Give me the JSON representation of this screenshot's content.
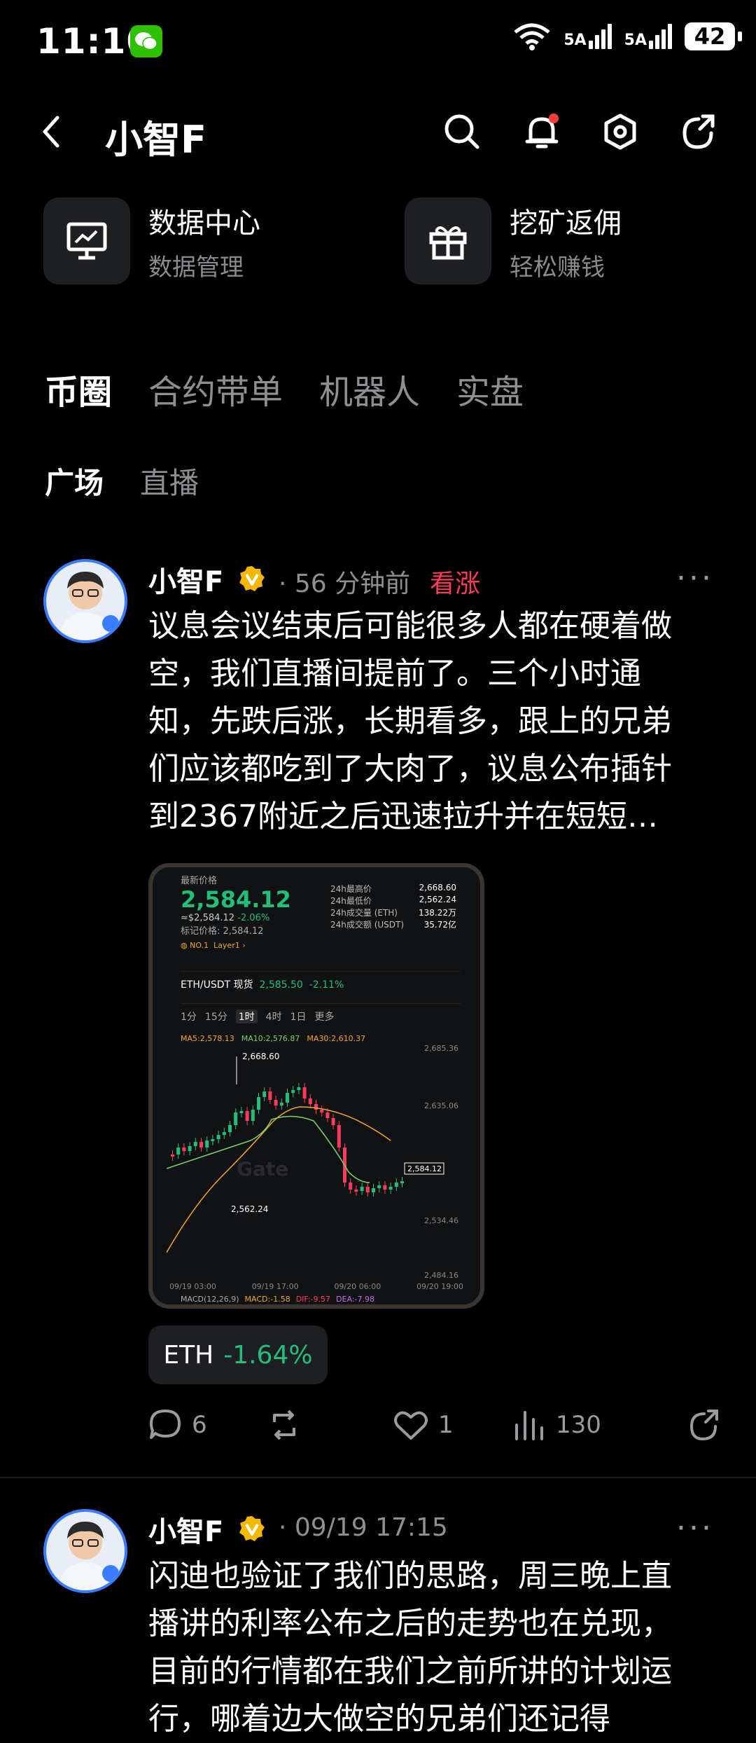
{
  "status_bar": {
    "time": "11:10",
    "net1": "5A",
    "net2": "5A",
    "battery": "42"
  },
  "header": {
    "title": "小智F"
  },
  "quick_cards": [
    {
      "title": "数据中心",
      "subtitle": "数据管理"
    },
    {
      "title": "挖矿返佣",
      "subtitle": "轻松赚钱"
    }
  ],
  "tabs": [
    "币圈",
    "合约带单",
    "机器人",
    "实盘"
  ],
  "subtabs": [
    "广场",
    "直播"
  ],
  "post1": {
    "author": "小智F",
    "time": "· 56 分钟前",
    "sentiment": "看涨",
    "lines": [
      "议息会议结束后可能很多人都在硬着做",
      "空，我们直播间提前了。三个小时通",
      "知，先跌后涨，长期看多，跟上的兄弟",
      "们应该都吃到了大肉了，议息公布插针",
      "到2367附近之后迅速拉升并在短短…"
    ],
    "chart": {
      "label": "最新价格",
      "price": "2,584.12",
      "usd": "≈$2,584.12",
      "change": "-2.06%",
      "mark": "标记价格: 2,584.12",
      "rank": "NO.1",
      "layer": "Layer1",
      "stats": [
        {
          "k": "24h最高价",
          "v": "2,668.60"
        },
        {
          "k": "24h最低价",
          "v": "2,562.24"
        },
        {
          "k": "24h成交量 (ETH)",
          "v": "138.22万"
        },
        {
          "k": "24h成交额 (USDT)",
          "v": "35.72亿"
        }
      ],
      "pair": "ETH/USDT 现货",
      "pair_price": "2,585.50",
      "pair_change": "-2.11%",
      "intervals": [
        "1分",
        "15分",
        "1时",
        "4时",
        "1日",
        "更多"
      ],
      "ma": {
        "ma5": "MA5:2,578.13",
        "ma10": "MA10:2,576.87",
        "ma30": "MA30:2,610.37"
      },
      "y_ticks": [
        "2,685.36",
        "2,635.06",
        "2,584.12",
        "2,534.46",
        "2,484.16"
      ],
      "high_label": "2,668.60",
      "low_label": "2,562.24",
      "x_ticks": [
        "09/19 03:00",
        "09/19 17:00",
        "09/20 06:00",
        "09/20 19:00"
      ],
      "macd": {
        "title": "MACD(12,26,9)",
        "macd": "MACD:-1.58",
        "dif": "DIF:-9.57",
        "dea": "DEA:-7.98"
      },
      "watermark": "Gate"
    },
    "tag": {
      "coin": "ETH",
      "change": "-1.64%"
    },
    "actions": {
      "comments": "6",
      "likes": "1",
      "views": "130"
    }
  },
  "post2": {
    "author": "小智F",
    "time": "· 09/19 17:15",
    "lines": [
      "闪迪也验证了我们的思路，周三晚上直",
      "播讲的利率公布之后的走势也在兑现，",
      "目前的行情都在我们之前所讲的计划运",
      "行，哪着边大做空的兄弟们还记得"
    ]
  },
  "colors": {
    "green": "#20c07a",
    "red": "#ff3b5c",
    "gold": "#f5b800",
    "accent": "#3b7bff"
  }
}
